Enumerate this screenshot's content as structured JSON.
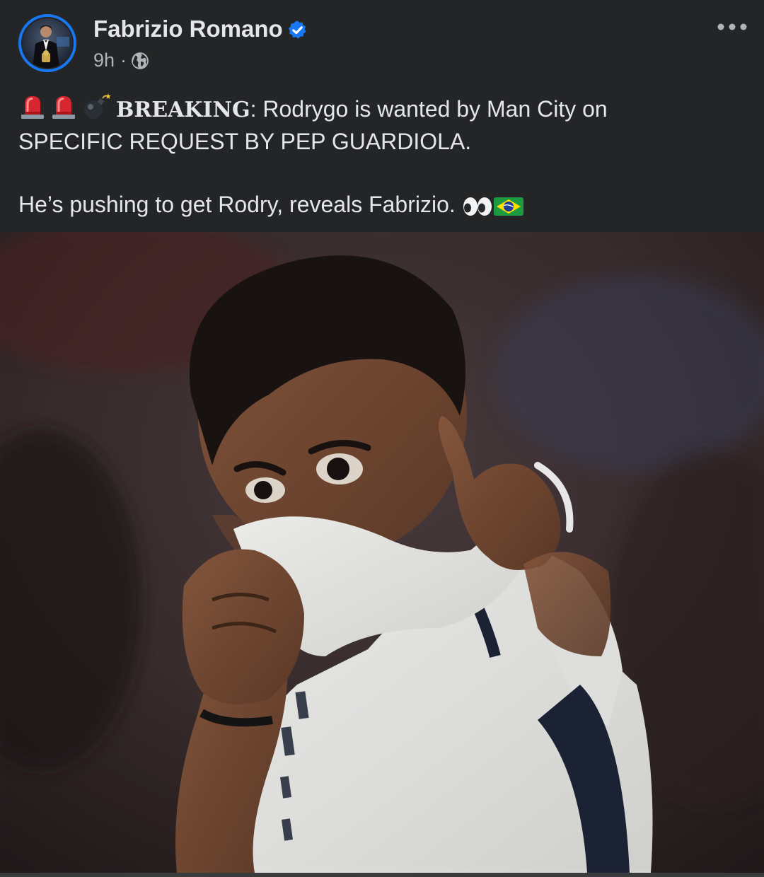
{
  "post": {
    "author": "Fabrizio Romano",
    "verified_icon": "verified-badge-icon",
    "time": "9h",
    "separator": "·",
    "privacy_icon": "globe-icon",
    "more_icon": "more-options-icon",
    "text": {
      "emojis_line1": [
        "siren-icon",
        "siren-icon",
        "bomb-icon"
      ],
      "breaking_label": "BREAKING",
      "line1_rest": ": Rodrygo is wanted by Man City on",
      "line2": "SPECIFIC REQUEST BY PEP GUARDIOLA.",
      "line3": "He’s pushing to get Rodry, reveals Fabrizio.",
      "emojis_line3": [
        "eyes-icon",
        "brazil-flag-icon"
      ]
    },
    "image": {
      "subject": "player-kissing-shirt-pointing-photo"
    }
  },
  "colors": {
    "background": "#242526",
    "text": "#e4e6eb",
    "secondary_text": "#b0b3b8",
    "verified": "#1877f2"
  }
}
